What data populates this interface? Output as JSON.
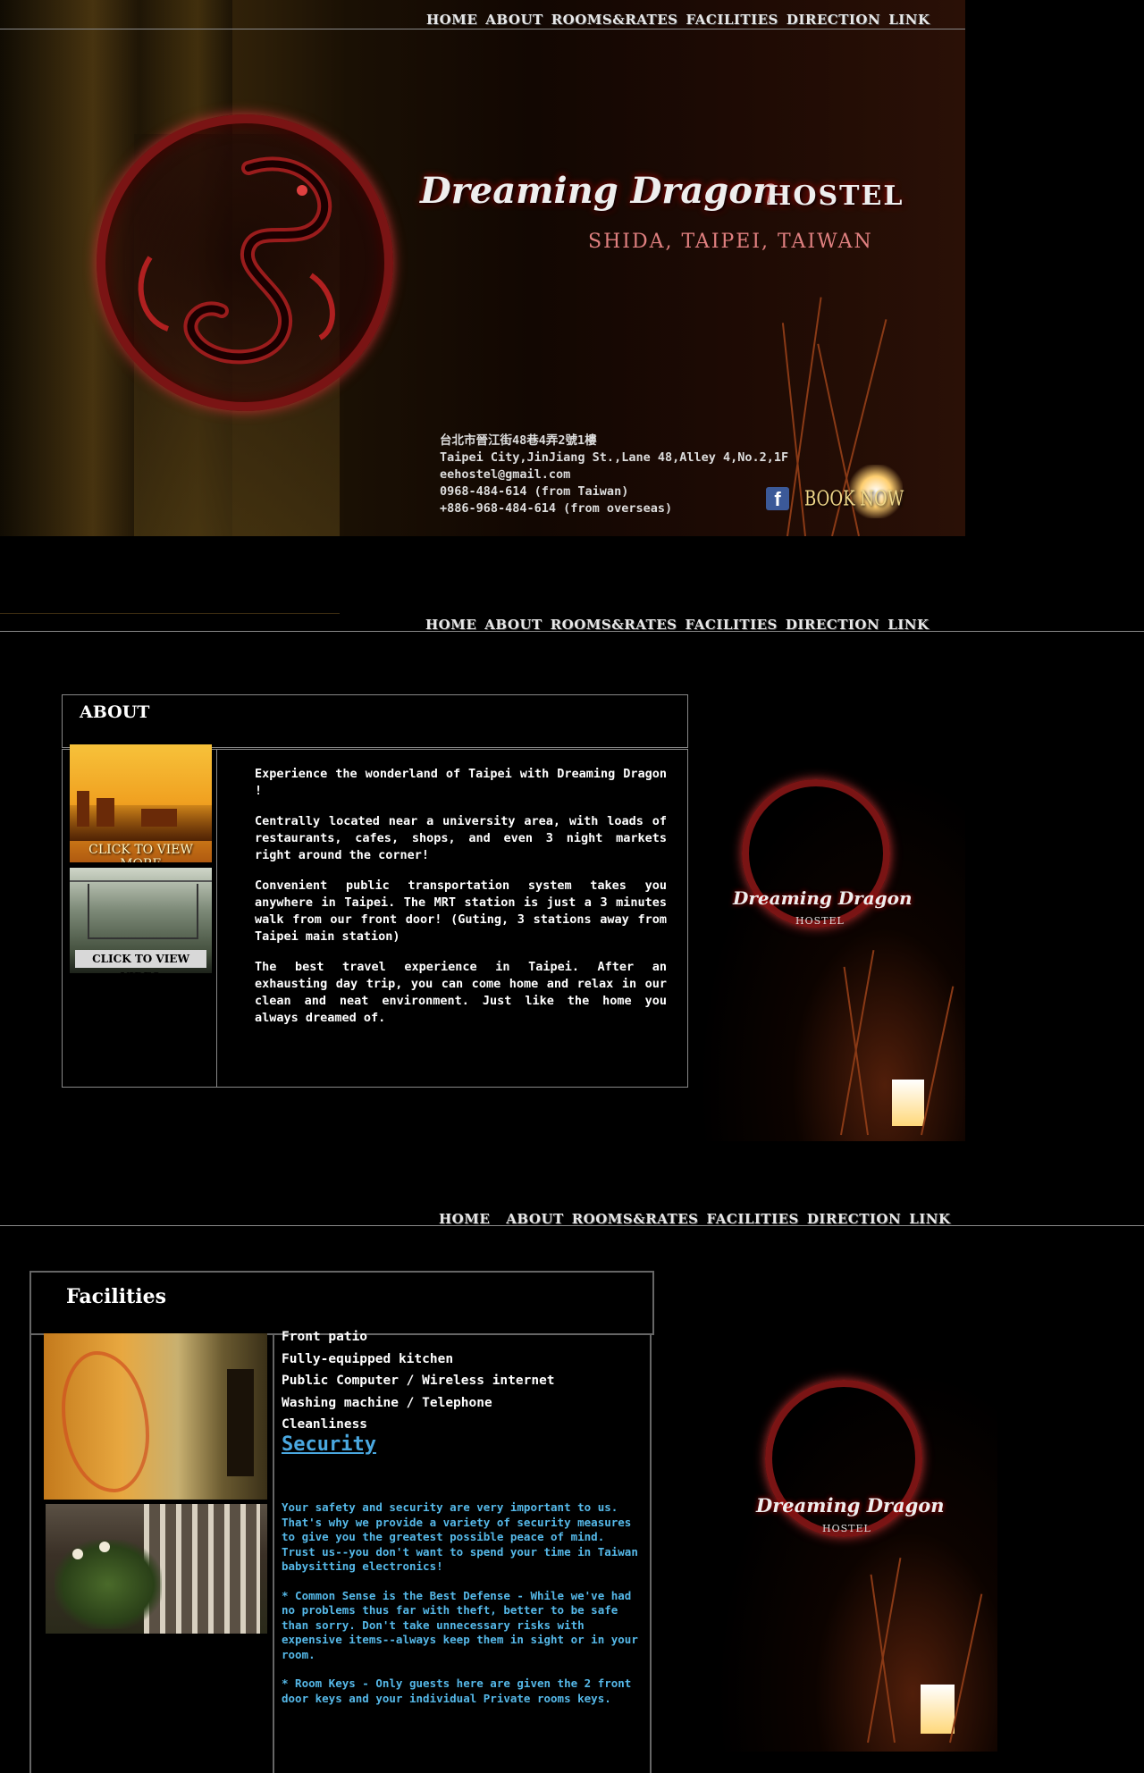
{
  "nav": {
    "home": "HOME",
    "about": "ABOUT",
    "rooms": "ROOMS&RATES",
    "facilities": "FACILITIES",
    "direction": "DIRECTION",
    "link": "LINK"
  },
  "header": {
    "title_script": "Dreaming Dragon",
    "title_word": "HOSTEL",
    "subtitle": "SHIDA, TAIPEI, TAIWAN",
    "address_cn": "台北市晉江街48巷4弄2號1樓",
    "address_en": "Taipei City,JinJiang St.,Lane 48,Alley 4,No.2,1F",
    "email": "eehostel@gmail.com",
    "phone_local": "0968-484-614 (from Taiwan)",
    "phone_overseas": "+886-968-484-614 (from overseas)",
    "facebook_glyph": "f",
    "book_now": "BOOK NOW"
  },
  "about": {
    "heading": "ABOUT",
    "thumb_more": "CLICK TO VIEW MORE",
    "thumb_video": "CLICK TO VIEW VIDEO",
    "paragraphs": [
      "Experience the wonderland of Taipei with Dreaming Dragon !",
      "Centrally located near a university area, with loads of restaurants, cafes, shops, and even 3 night markets right around the corner!",
      "Convenient public transportation system takes you anywhere in Taipei. The MRT station is just a 3 minutes walk from our front door! (Guting, 3 stations away from Taipei main station)",
      "The best travel experience in Taipei. After an exhausting day trip, you can come home and relax in our clean and neat environment. Just like the home you always dreamed of."
    ],
    "side_logo_script": "Dreaming Dragon",
    "side_logo_word": "HOSTEL"
  },
  "facilities": {
    "heading": "Facilities",
    "items": [
      "Front patio",
      "Fully-equipped kitchen",
      "Public Computer / Wireless internet",
      "Washing machine / Telephone",
      "Cleanliness"
    ],
    "security_title": "Security",
    "security_paragraphs": [
      "Your safety and security are very important to us. That's why we provide a variety of security measures to give you the greatest possible peace of mind. Trust us--you don't want to spend your time in Taiwan babysitting electronics!",
      "* Common Sense is the Best Defense - While we've had no problems thus far with theft, better to be safe than sorry. Don't take unnecessary risks with expensive items--always keep them in sight or in your room.",
      "* Room Keys - Only guests here are given the 2 front door keys and your individual Private rooms keys."
    ],
    "side_logo_script": "Dreaming Dragon",
    "side_logo_word": "HOSTEL"
  },
  "colors": {
    "accent_red": "#7a1414",
    "link_blue": "#4aa8e0",
    "text_blue": "#55b8e8"
  }
}
